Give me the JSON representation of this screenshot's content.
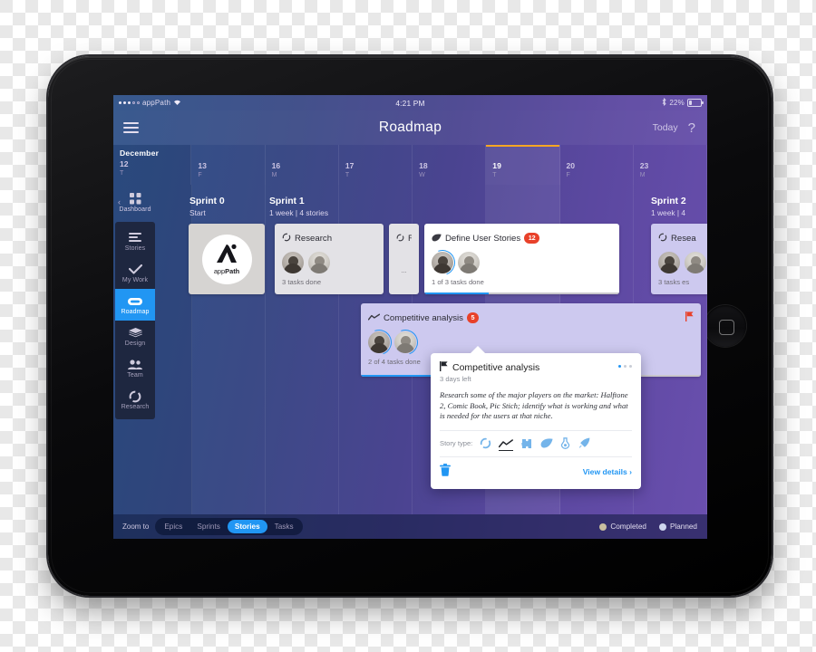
{
  "status_bar": {
    "carrier": "appPath",
    "signal_dots_filled": 3,
    "signal_dots_total": 5,
    "wifi_icon": "wifi-icon",
    "time": "4:21 PM",
    "bluetooth_icon": "bluetooth-icon",
    "battery_percent": "22%"
  },
  "nav": {
    "menu_icon": "hamburger-menu-icon",
    "title": "Roadmap",
    "today_label": "Today",
    "help_label": "?"
  },
  "timeline": {
    "month": "December",
    "days": [
      {
        "num": "12",
        "letter": "T",
        "today": false
      },
      {
        "num": "13",
        "letter": "F",
        "today": false
      },
      {
        "num": "16",
        "letter": "M",
        "today": false
      },
      {
        "num": "17",
        "letter": "T",
        "today": false
      },
      {
        "num": "18",
        "letter": "W",
        "today": false
      },
      {
        "num": "19",
        "letter": "T",
        "today": true
      },
      {
        "num": "20",
        "letter": "F",
        "today": false
      },
      {
        "num": "23",
        "letter": "M",
        "today": false
      }
    ]
  },
  "sidebar": {
    "back_chevron": "chevron-left-icon",
    "dashboard": {
      "label": "Dashboard",
      "icon": "grid-icon"
    },
    "items": [
      {
        "label": "Stories",
        "icon": "list-icon",
        "active": false
      },
      {
        "label": "My Work",
        "icon": "check-icon",
        "active": false
      },
      {
        "label": "Roadmap",
        "icon": "roadmap-icon",
        "active": true
      },
      {
        "label": "Design",
        "icon": "layers-icon",
        "active": false
      },
      {
        "label": "Team",
        "icon": "people-icon",
        "active": false
      },
      {
        "label": "Research",
        "icon": "circle-dashed-icon",
        "active": false
      }
    ]
  },
  "sprints": [
    {
      "title": "Sprint 0",
      "subtitle": "Start"
    },
    {
      "title": "Sprint 1",
      "subtitle": "1 week | 4 stories"
    },
    {
      "title": "Sprint 2",
      "subtitle": "1 week | 4"
    }
  ],
  "cards": {
    "logo": {
      "mark": "appPath-logo-icon",
      "name_light": "app",
      "name_bold": "Path"
    },
    "research": {
      "title": "Research",
      "icon": "circle-dashed-icon",
      "footer": "3 tasks done",
      "progress": 100
    },
    "research_clipped": {
      "title": "R...",
      "icon": "circle-dashed-icon",
      "footer": "..."
    },
    "define_user_stories": {
      "title": "Define User Stories",
      "icon": "leaf-icon",
      "badge": "12",
      "footer": "1 of 3 tasks done",
      "progress": 33
    },
    "competitive_analysis": {
      "title": "Competitive analysis",
      "icon": "chart-line-icon",
      "badge": "5",
      "flag_icon": "flag-icon",
      "footer": "2 of 4 tasks done",
      "progress": 50
    },
    "research_sprint2": {
      "title": "Resea",
      "icon": "circle-dashed-icon",
      "footer": "3 tasks es"
    }
  },
  "popover": {
    "flag_icon": "flag-icon",
    "title": "Competitive analysis",
    "menu_icon": "more-dots-icon",
    "subtitle": "3 days left",
    "description": "Research some of the major players on the market: Halftone 2,  Comic Book, Pic Stich; identify what is working and what is needed for the users at that niche.",
    "story_type_label": "Story type:",
    "story_types": [
      {
        "icon": "circle-dashed-icon",
        "selected": false
      },
      {
        "icon": "chart-line-icon",
        "selected": true
      },
      {
        "icon": "puzzle-icon",
        "selected": false
      },
      {
        "icon": "leaf-icon",
        "selected": false
      },
      {
        "icon": "flask-icon",
        "selected": false
      },
      {
        "icon": "rocket-icon",
        "selected": false
      }
    ],
    "delete_icon": "trash-icon",
    "view_details_label": "View details ›"
  },
  "bottom_bar": {
    "zoom_label": "Zoom to",
    "zoom_options": [
      {
        "label": "Epics",
        "active": false
      },
      {
        "label": "Sprints",
        "active": false
      },
      {
        "label": "Stories",
        "active": true
      },
      {
        "label": "Tasks",
        "active": false
      }
    ],
    "legend": [
      {
        "label": "Completed",
        "color": "#c9bfa0"
      },
      {
        "label": "Planned",
        "color": "#cfd6ef"
      }
    ]
  },
  "device": {
    "home_button_icon": "home-button-icon",
    "camera_icon": "front-camera-icon"
  },
  "colors": {
    "accent_blue": "#2196f3",
    "badge_red": "#e8412a",
    "today_marker": "#f6a623"
  }
}
